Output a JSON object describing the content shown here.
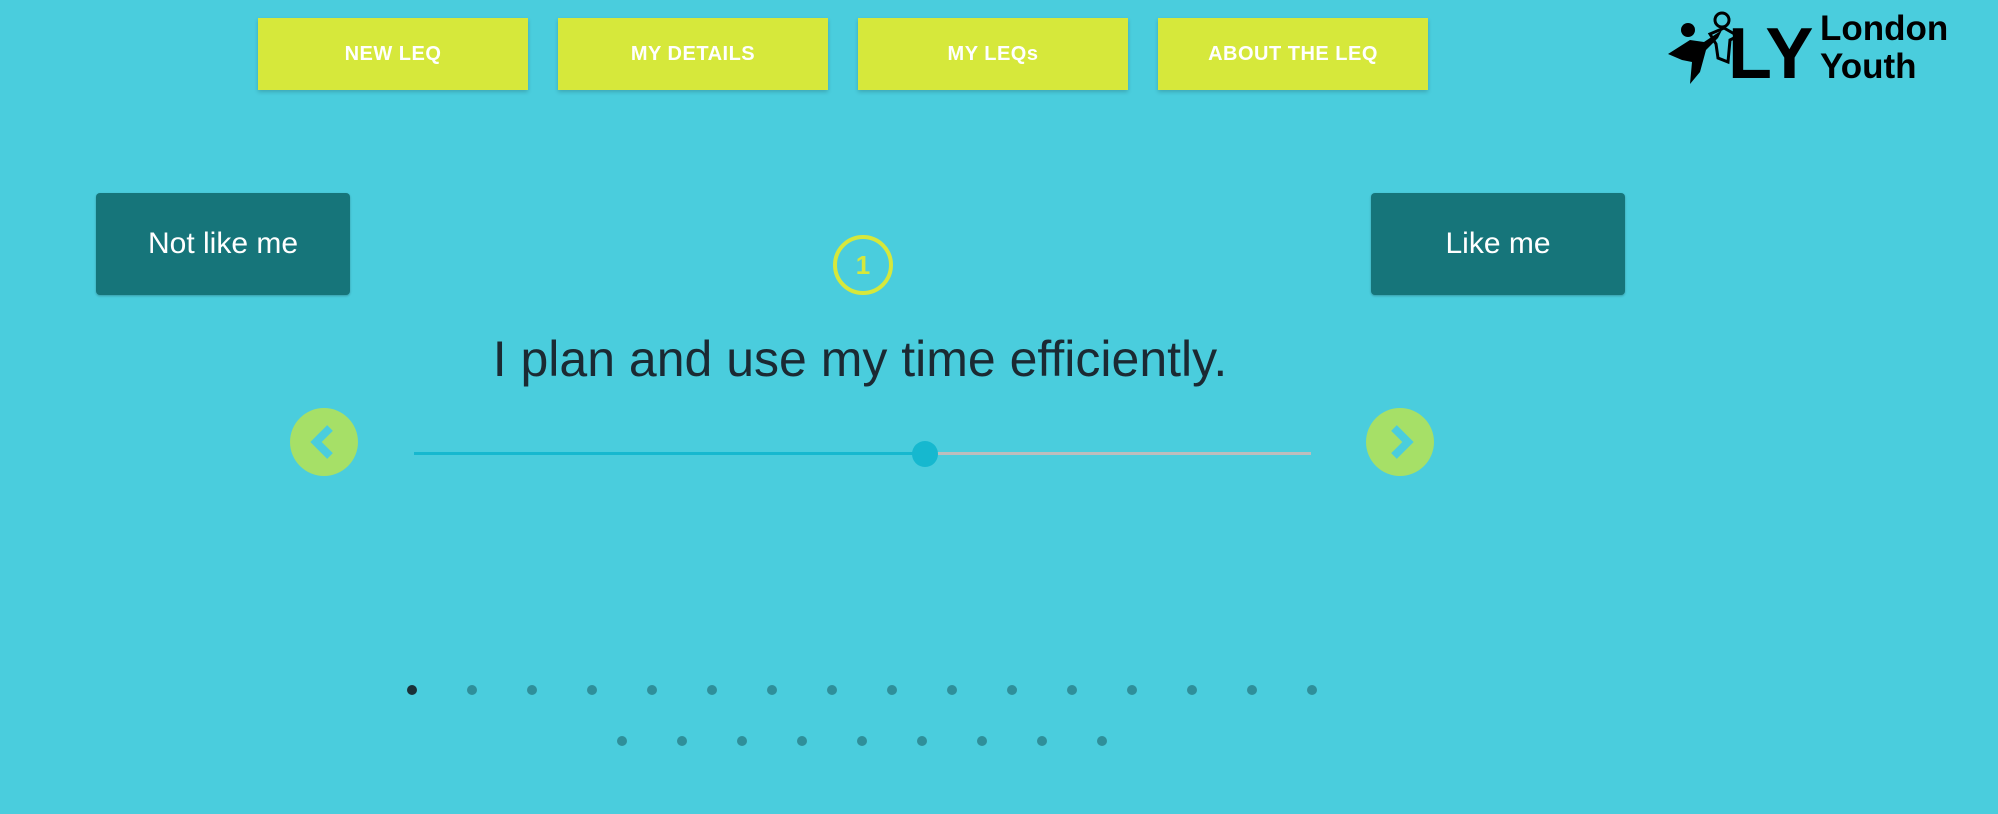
{
  "nav": {
    "items": [
      {
        "label": "NEW LEQ"
      },
      {
        "label": "MY DETAILS"
      },
      {
        "label": "MY LEQs"
      },
      {
        "label": "ABOUT THE LEQ"
      }
    ]
  },
  "logo": {
    "initials": "LY",
    "name_line1": "London",
    "name_line2": "Youth"
  },
  "scale": {
    "left_label": "Not like me",
    "right_label": "Like me"
  },
  "question": {
    "number": "1",
    "text": "I plan and use my time efficiently."
  },
  "slider": {
    "value_fraction": 0.57
  },
  "pagination": {
    "total": 25,
    "current": 1
  },
  "colors": {
    "background": "#4acddd",
    "nav_button": "#d6e83b",
    "side_button": "#16757a",
    "arrow_button": "#a6e067",
    "slider_active": "#16b8cf"
  },
  "icons": {
    "prev": "chevron-left-icon",
    "next": "chevron-right-icon"
  }
}
